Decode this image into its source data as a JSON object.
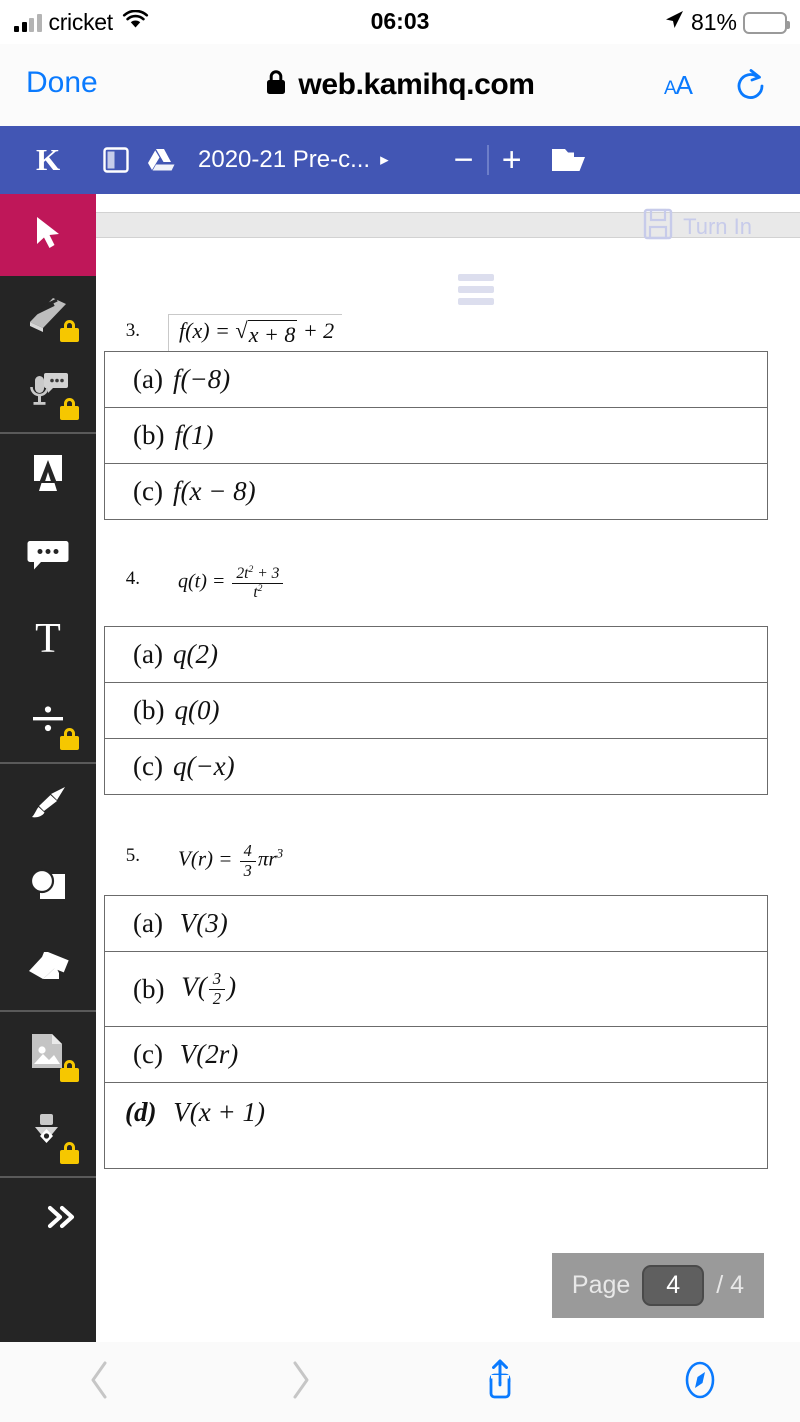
{
  "status_bar": {
    "carrier": "cricket",
    "time": "06:03",
    "battery_percent": "81%",
    "battery_level": 81,
    "icons": [
      "cellular-signal-icon",
      "wifi-icon",
      "location-arrow-icon",
      "battery-icon"
    ]
  },
  "browser": {
    "done_label": "Done",
    "url": "web.kamihq.com",
    "text_size_label": "AA",
    "icons": [
      "lock-icon",
      "reload-icon",
      "back-icon",
      "forward-icon",
      "share-icon",
      "tabs-icon"
    ]
  },
  "kami_header": {
    "logo": "K",
    "document_title": "2020-21 Pre-c...",
    "caret": "▸",
    "zoom_out": "−",
    "zoom_in": "+",
    "icons": [
      "panel-toggle-icon",
      "google-drive-icon",
      "folder-open-icon"
    ],
    "bar_color": "#4256b4"
  },
  "sidebar": {
    "active_color": "#bf1759",
    "background": "#252525",
    "tools": [
      {
        "name": "select-tool",
        "icon": "cursor-arrow-icon",
        "active": true,
        "locked": false
      },
      {
        "name": "read-aloud-tool",
        "icon": "book-icon",
        "active": false,
        "locked": true
      },
      {
        "name": "voice-comment-tool",
        "icon": "microphone-comment-icon",
        "active": false,
        "locked": true
      },
      {
        "name": "highlight-tool",
        "icon": "highlight-a-icon",
        "active": false,
        "locked": false
      },
      {
        "name": "comment-tool",
        "icon": "comment-bubble-icon",
        "active": false,
        "locked": false
      },
      {
        "name": "text-tool",
        "icon": "text-t-icon",
        "active": false,
        "locked": false
      },
      {
        "name": "equation-tool",
        "icon": "divide-icon",
        "active": false,
        "locked": true
      },
      {
        "name": "draw-tool",
        "icon": "pen-brush-icon",
        "active": false,
        "locked": false
      },
      {
        "name": "shapes-tool",
        "icon": "shapes-icon",
        "active": false,
        "locked": false
      },
      {
        "name": "eraser-tool",
        "icon": "eraser-icon",
        "active": false,
        "locked": false
      },
      {
        "name": "insert-image-tool",
        "icon": "image-file-icon",
        "active": false,
        "locked": true
      },
      {
        "name": "signature-tool",
        "icon": "signature-pen-icon",
        "active": false,
        "locked": true
      },
      {
        "name": "expand-toolbar",
        "icon": "chevron-double-right-icon",
        "active": false,
        "locked": false
      },
      {
        "name": "scroll-down",
        "icon": "chevron-double-down-icon",
        "active": false,
        "locked": false
      }
    ]
  },
  "document": {
    "turn_in_label": "Turn In",
    "menu_icon": "hamburger-menu-icon",
    "page_label": "Page",
    "page_current": "4",
    "page_total": "/ 4",
    "questions": [
      {
        "number": "3.",
        "expression": "f(x) = √(x + 8) + 2",
        "parts": [
          {
            "label": "(a)",
            "expr": "f(−8)"
          },
          {
            "label": "(b)",
            "expr": "f(1)"
          },
          {
            "label": "(c)",
            "expr": "f(x − 8)"
          }
        ]
      },
      {
        "number": "4.",
        "expression": "q(t) = (2t² + 3) / t²",
        "parts": [
          {
            "label": "(a)",
            "expr": "q(2)"
          },
          {
            "label": "(b)",
            "expr": "q(0)"
          },
          {
            "label": "(c)",
            "expr": "q(−x)"
          }
        ]
      },
      {
        "number": "5.",
        "expression": "V(r) = (4/3)πr³",
        "parts": [
          {
            "label": "(a)",
            "expr": "V(3)"
          },
          {
            "label": "(b)",
            "expr": "V(3/2)"
          },
          {
            "label": "(c)",
            "expr": "V(2r)"
          },
          {
            "label": "(d)",
            "expr": "V(x + 1)"
          }
        ]
      }
    ]
  }
}
